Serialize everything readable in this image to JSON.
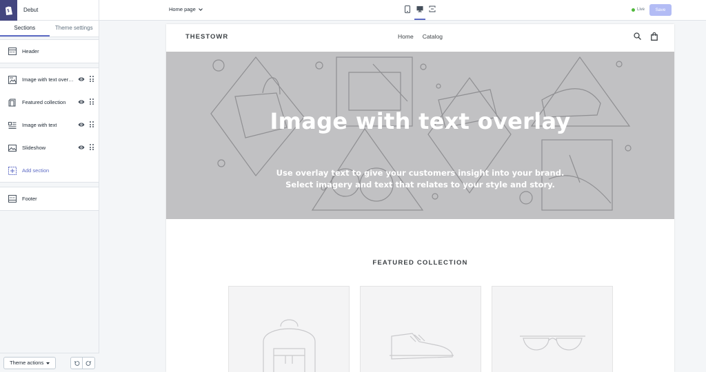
{
  "app": {
    "theme_name": "Debut"
  },
  "sidebar": {
    "tabs": [
      {
        "label": "Sections",
        "active": true
      },
      {
        "label": "Theme settings",
        "active": false
      }
    ],
    "header_item": {
      "label": "Header",
      "icon": "header-layout-icon"
    },
    "sections": [
      {
        "label": "Image with text overlay",
        "icon": "image-overlay-icon",
        "visible": true
      },
      {
        "label": "Featured collection",
        "icon": "collection-icon",
        "visible": true
      },
      {
        "label": "Image with text",
        "icon": "image-text-icon",
        "visible": true
      },
      {
        "label": "Slideshow",
        "icon": "slideshow-icon",
        "visible": true
      }
    ],
    "add_section": {
      "label": "Add section",
      "icon": "add-section-icon"
    },
    "footer_item": {
      "label": "Footer",
      "icon": "footer-layout-icon"
    },
    "bottom": {
      "theme_actions_label": "Theme actions"
    }
  },
  "topbar": {
    "page_select": "Home page",
    "devices": [
      {
        "name": "mobile-icon",
        "active": false
      },
      {
        "name": "desktop-icon",
        "active": true
      },
      {
        "name": "fullscreen-icon",
        "active": false
      }
    ],
    "status": "Live",
    "save_label": "Save"
  },
  "store": {
    "name": "THESTOWR",
    "nav": [
      "Home",
      "Catalog"
    ],
    "hero": {
      "title": "Image with text overlay",
      "subtitle_line1": "Use overlay text to give your customers insight into your brand.",
      "subtitle_line2": "Select imagery and text that relates to your style and story."
    },
    "featured_title": "FEATURED COLLECTION",
    "products": [
      {
        "placeholder": "backpack-placeholder-icon"
      },
      {
        "placeholder": "sneaker-placeholder-icon"
      },
      {
        "placeholder": "glasses-placeholder-icon"
      }
    ]
  },
  "colors": {
    "accent": "#5c6ac4",
    "logo_bg": "#43467f",
    "hero_bg": "#c1c1c3",
    "live_dot": "#50b83c",
    "save_disabled": "#b3bcf5"
  }
}
